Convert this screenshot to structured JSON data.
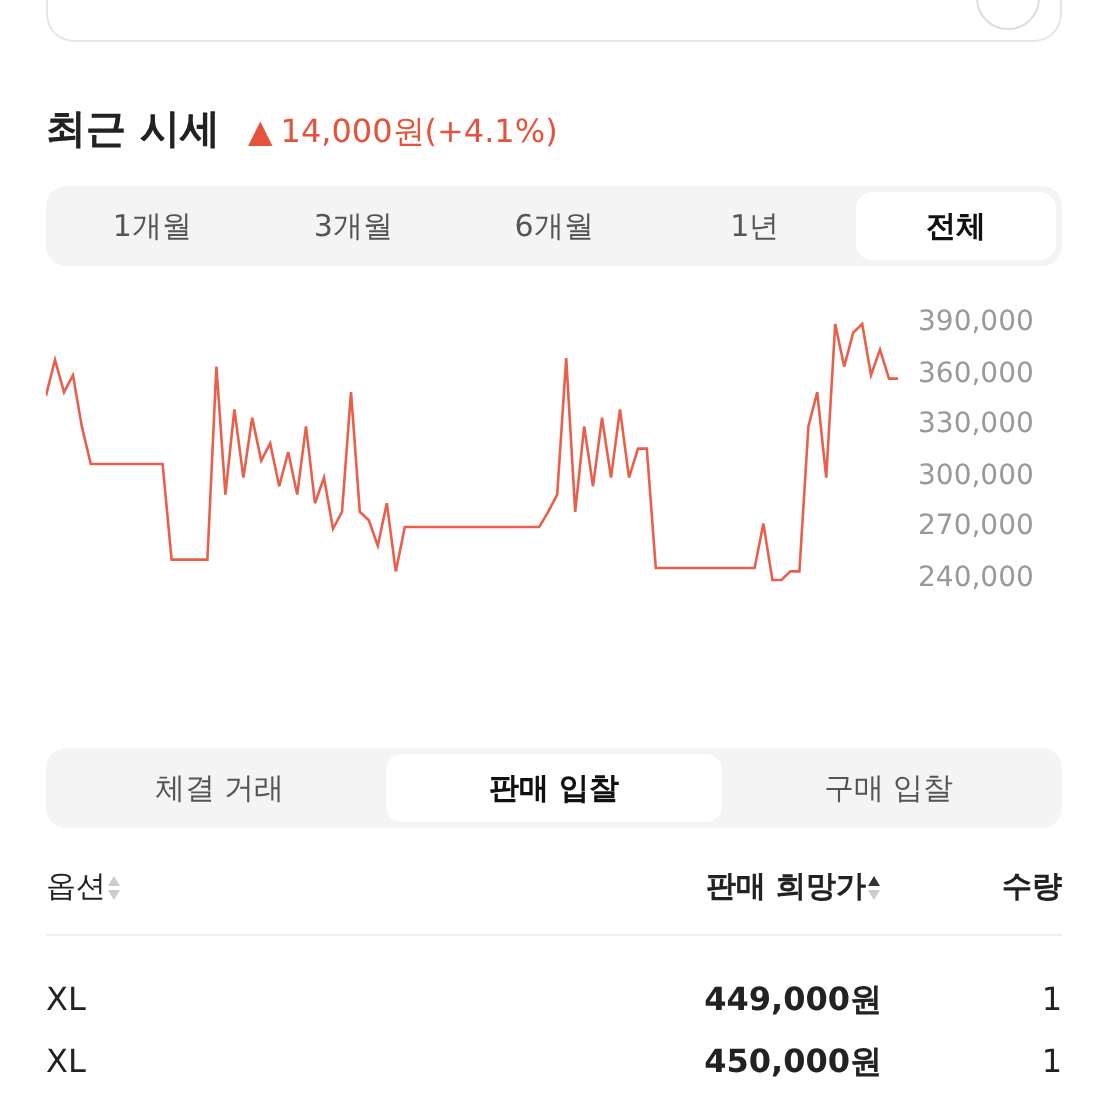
{
  "recent_price": {
    "title": "최근 시세",
    "arrow": "▲",
    "change": "14,000원(+4.1%)"
  },
  "period_tabs": [
    {
      "label": "1개월",
      "selected": false
    },
    {
      "label": "3개월",
      "selected": false
    },
    {
      "label": "6개월",
      "selected": false
    },
    {
      "label": "1년",
      "selected": false
    },
    {
      "label": "전체",
      "selected": true
    }
  ],
  "chart_data": {
    "type": "line",
    "ylim": [
      240000,
      390000
    ],
    "yticks": [
      {
        "value": 390000,
        "label": "390,000"
      },
      {
        "value": 360000,
        "label": "360,000"
      },
      {
        "value": 330000,
        "label": "330,000"
      },
      {
        "value": 300000,
        "label": "300,000"
      },
      {
        "value": 270000,
        "label": "270,000"
      },
      {
        "value": 240000,
        "label": "240,000"
      }
    ],
    "series": [
      {
        "color": "#e8604c",
        "values": [
          348000,
          369000,
          350000,
          360000,
          330000,
          308000,
          308000,
          308000,
          308000,
          308000,
          308000,
          308000,
          308000,
          308000,
          252000,
          252000,
          252000,
          252000,
          252000,
          365000,
          290000,
          340000,
          300000,
          335000,
          310000,
          320000,
          295000,
          315000,
          290000,
          330000,
          285000,
          300000,
          270000,
          280000,
          350000,
          280000,
          275000,
          260000,
          285000,
          245000,
          271000,
          271000,
          271000,
          271000,
          271000,
          271000,
          271000,
          271000,
          271000,
          271000,
          271000,
          271000,
          271000,
          271000,
          271000,
          271000,
          280000,
          290000,
          370000,
          280000,
          330000,
          295000,
          335000,
          300000,
          340000,
          300000,
          317000,
          317000,
          247000,
          247000,
          247000,
          247000,
          247000,
          247000,
          247000,
          247000,
          247000,
          247000,
          247000,
          247000,
          273000,
          240000,
          240000,
          245000,
          245000,
          330000,
          350000,
          300000,
          390000,
          365000,
          385000,
          390000,
          360000,
          375000,
          358000,
          358000
        ]
      }
    ]
  },
  "bid_tabs": [
    {
      "label": "체결 거래",
      "selected": false
    },
    {
      "label": "판매 입찰",
      "selected": true
    },
    {
      "label": "구매 입찰",
      "selected": false
    }
  ],
  "table": {
    "columns": [
      {
        "label": "옵션",
        "ascending": false
      },
      {
        "label": "판매 희망가",
        "ascending": true
      },
      {
        "label": "수량"
      }
    ],
    "rows": [
      [
        "XL",
        "449,000원",
        "1"
      ],
      [
        "XL",
        "450,000원",
        "1"
      ]
    ]
  }
}
